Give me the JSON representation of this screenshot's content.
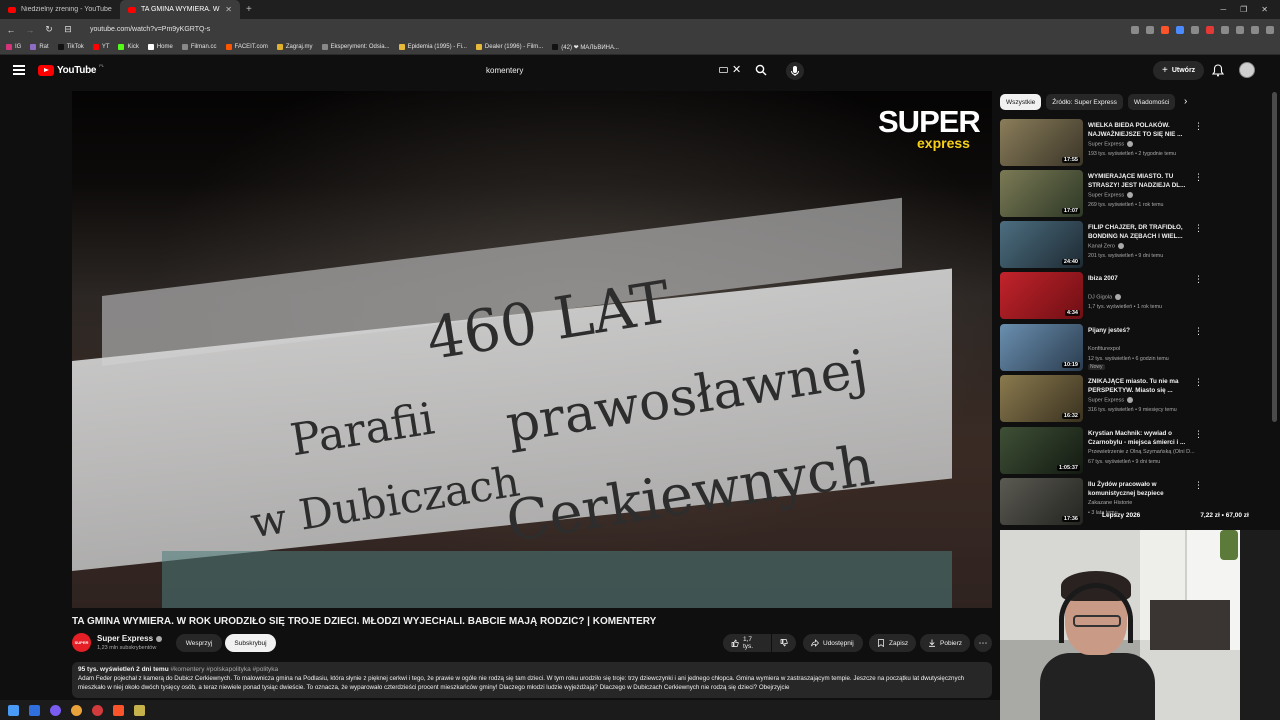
{
  "browser": {
    "tabs": [
      {
        "title": "Niedzielny żrening - YouTube",
        "active": false
      },
      {
        "title": "TA GMINA WYMIERA. W ROK",
        "active": true
      }
    ],
    "url": "youtube.com/watch?v=Pm9yKGRTQ-s",
    "bookmarks": [
      "IG",
      "Rat",
      "TikTok",
      "YT",
      "Kick",
      "Home",
      "Filman.cc",
      "FACEIT.com",
      "Zagraj.my",
      "Eksperyment: Odsia...",
      "Epidemia (1995) - Fi...",
      "Dealer (1996) - Film...",
      "(42) ❤ МАЛЬВИНА..."
    ]
  },
  "header": {
    "logo": "YouTube",
    "country": "PL",
    "search_value": "komentery",
    "create_label": "Utwórz"
  },
  "video": {
    "overlay_brand": "SUPER",
    "overlay_brand_sub": "express",
    "sign_lines": [
      "460 LAT",
      "Parafii",
      "prawosławnej",
      "w Dubiczach",
      "Cerkiewnych"
    ],
    "title": "TA GMINA WYMIERA. W ROK URODZIŁO SIĘ TROJE DZIECI. MŁODZI WYJECHALI. BABCIE MAJĄ RODZIĆ? | KOMENTERY",
    "channel": {
      "name": "Super Express",
      "avatar_text": "SUPER",
      "subscribers": "1,23 mln subskrybentów"
    },
    "support_label": "Wesprzyj",
    "subscribe_label": "Subskrybuj",
    "likes": "1,7 tys.",
    "share_label": "Udostępnij",
    "save_label": "Zapisz",
    "download_label": "Pobierz",
    "description": {
      "views_date": "95 tys. wyświetleń  2 dni temu",
      "tags": "#komentery #polskapolityka #polityka",
      "text": "Adam Feder pojechał z kamerą do Dubicz Cerkiewnych. To malownicza gmina na Podlasiu, która słynie z pięknej cerkwi i tego, że prawie w ogóle nie rodzą się tam dzieci. W tym roku urodziło się troje: trzy dziewczynki i ani jednego chłopca. Gmina wymiera w zastraszającym tempie. Jeszcze na początku lat dwutysięcznych mieszkało w niej około dwóch tysięcy osób, a teraz niewiele ponad tysiąc dwieście. To oznacza, że wyparowało czterdzieści procent mieszkańców gminy! Dlaczego młodzi ludzie wyjeżdżają? Dlaczego w Dubiczach Cerkiewnych nie rodzą się dzieci? Obejrzyjcie"
    }
  },
  "chips": [
    "Wszystkie",
    "Źródło: Super Express",
    "Wiadomości"
  ],
  "recommendations": [
    {
      "title": "WIELKA BIEDA POLAKÓW. NAJWAŻNIEJSZE TO SIĘ NIE ...",
      "channel": "Super Express",
      "verified": true,
      "meta": "193 tys. wyświetleń • 2 tygodnie temu",
      "duration": "17:55",
      "thumb": "#5a5346"
    },
    {
      "title": "WYMIERAJĄCE MIASTO. TU STRASZY! JEST NADZIEJA DL...",
      "channel": "Super Express",
      "verified": true,
      "meta": "269 tys. wyświetleń • 1 rok temu",
      "duration": "17:07",
      "thumb": "#6b6448"
    },
    {
      "title": "FILIP CHAJZER, DR TRAFIDŁO, BONDING NA ZĘBACH I WIEL...",
      "channel": "Kanał Zero",
      "verified": true,
      "meta": "201 tys. wyświetleń • 9 dni temu",
      "duration": "24:40",
      "thumb": "#3b4f5c"
    },
    {
      "title": "Ibiza 2007",
      "channel": "DJ Gigola",
      "verified": true,
      "meta": "1,7 tys. wyświetleń • 1 rok temu",
      "duration": "4:34",
      "thumb": "#b01c22"
    },
    {
      "title": "Pijany jesteś?",
      "channel": "Konfiturexpol",
      "verified": false,
      "meta": "12 tys. wyświetleń • 6 godzin temu",
      "duration": "10:19",
      "thumb": "#4a6a86",
      "badge": "Nowy"
    },
    {
      "title": "ZNIKAJĄCE miasto. Tu nie ma PERSPEKTYW. Miasto się ...",
      "channel": "Super Express",
      "verified": true,
      "meta": "316 tys. wyświetleń • 9 miesięcy temu",
      "duration": "16:32",
      "thumb": "#655a40"
    },
    {
      "title": "Krystian Machnik: wywiad o Czarnobylu - miejsca śmierci i ...",
      "channel": "Przewietrzenie z Olną Szymańską (Olni D...",
      "verified": false,
      "meta": "67 tys. wyświetleń • 9 dni temu",
      "duration": "1:05:37",
      "thumb": "#2e3a2e"
    },
    {
      "title": "Ilu Żydów pracowało w komunistycznej bezpiece",
      "channel": "Zakazane Historie",
      "verified": false,
      "meta": "• 3 lata temu",
      "duration": "17:36",
      "thumb": "#3a3a36"
    }
  ],
  "overlay_tray": {
    "left": "Lepszy 2026",
    "right": "7,22 zł • 67,00 zł"
  },
  "colors": {
    "accent": "#ff0000",
    "background": "#0f0f0f",
    "surface": "#272727",
    "brand_yellow": "#f7d117"
  }
}
